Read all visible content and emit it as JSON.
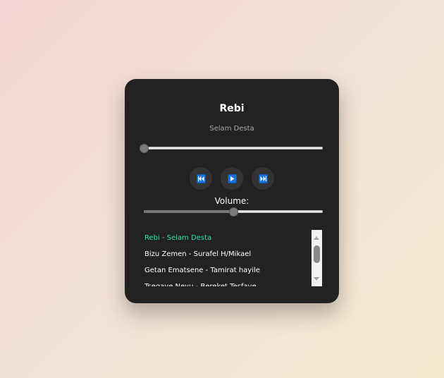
{
  "now_playing": {
    "title": "Rebi",
    "artist": "Selam Desta",
    "progress_fraction": 0.0
  },
  "controls": {
    "prev_icon": "skip-previous-icon",
    "play_icon": "play-icon",
    "next_icon": "skip-next-icon",
    "accent_color": "#1a73d9"
  },
  "volume": {
    "label": "Volume:",
    "level_fraction": 0.5
  },
  "playlist": {
    "active_color": "#2de0b0",
    "tracks": [
      "Rebi - Selam Desta",
      "Bizu Zemen - Surafel H/Mikael",
      "Getan Ematsene - Tamirat hayile",
      "Tsegaye Neyu - Bereket Tesfaye"
    ],
    "active_index": 0
  }
}
